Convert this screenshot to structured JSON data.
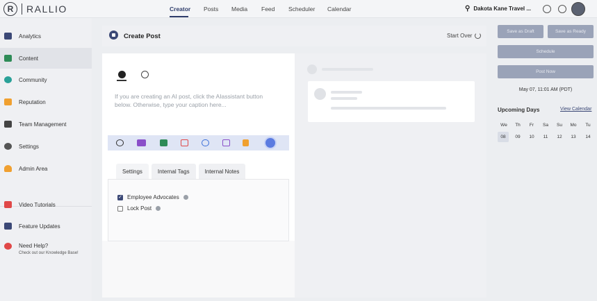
{
  "app": {
    "logo_text": "RALLIO",
    "logo_mark": "R"
  },
  "nav": {
    "items": [
      "Creator",
      "Posts",
      "Media",
      "Feed",
      "Scheduler",
      "Calendar"
    ],
    "active": "Creator"
  },
  "account": {
    "name": "Dakota Kane Travel ...",
    "icons": [
      "location-pin-icon",
      "bell-icon",
      "globe-icon"
    ]
  },
  "sidebar": {
    "items": [
      {
        "label": "Analytics",
        "icon": "chart-icon",
        "color": "#3b4876"
      },
      {
        "label": "Content",
        "icon": "content-icon",
        "color": "#2e8b57",
        "active": true
      },
      {
        "label": "Community",
        "icon": "chat-icon",
        "color": "#2aa198"
      },
      {
        "label": "Reputation",
        "icon": "star-person-icon",
        "color": "#f0a030"
      },
      {
        "label": "Team Management",
        "icon": "list-icon",
        "color": "#444444"
      },
      {
        "label": "Settings",
        "icon": "gear-icon",
        "color": "#555555"
      },
      {
        "label": "Admin Area",
        "icon": "person-icon",
        "color": "#f0a030"
      }
    ],
    "secondary": [
      {
        "label": "Video Tutorials",
        "icon": "video-icon",
        "color": "#e04848"
      },
      {
        "label": "Feature Updates",
        "icon": "megaphone-icon",
        "color": "#3b4876"
      },
      {
        "label": "Need Help?",
        "sub": "Check out our Knowledge Base!",
        "icon": "lifebuoy-icon",
        "color": "#e04848"
      }
    ]
  },
  "create_post": {
    "title": "Create Post",
    "start_over": "Start Over",
    "networks": [
      "facebook-icon",
      "instagram-icon"
    ],
    "caption_placeholder": "If you are creating an AI post, click the AIassistant button below. Otherwise, type your caption here...",
    "toolbar_icons": [
      "emoji-icon",
      "ai-text-icon",
      "image-icon",
      "video-icon",
      "link-icon",
      "edit-image-icon",
      "hashtag-icon",
      "ai-assistant-icon"
    ],
    "tabs": [
      "Settings",
      "Internal Tags",
      "Internal Notes"
    ],
    "active_tab": "Settings",
    "options": [
      {
        "label": "Employee Advocates",
        "checked": true
      },
      {
        "label": "Lock Post",
        "checked": false
      }
    ]
  },
  "actions": {
    "save_draft": "Save as Draft",
    "save_ready": "Save as Ready",
    "schedule": "Schedule",
    "post_now": "Post Now",
    "schedule_time": "May 07, 11:01 AM (PDT)"
  },
  "upcoming": {
    "title": "Upcoming Days",
    "view_calendar": "View Calendar",
    "days": [
      {
        "name": "We",
        "num": "08",
        "today": true
      },
      {
        "name": "Th",
        "num": "09"
      },
      {
        "name": "Fr",
        "num": "10"
      },
      {
        "name": "Sa",
        "num": "11"
      },
      {
        "name": "Su",
        "num": "12"
      },
      {
        "name": "Mo",
        "num": "13"
      },
      {
        "name": "Tu",
        "num": "14"
      }
    ]
  }
}
